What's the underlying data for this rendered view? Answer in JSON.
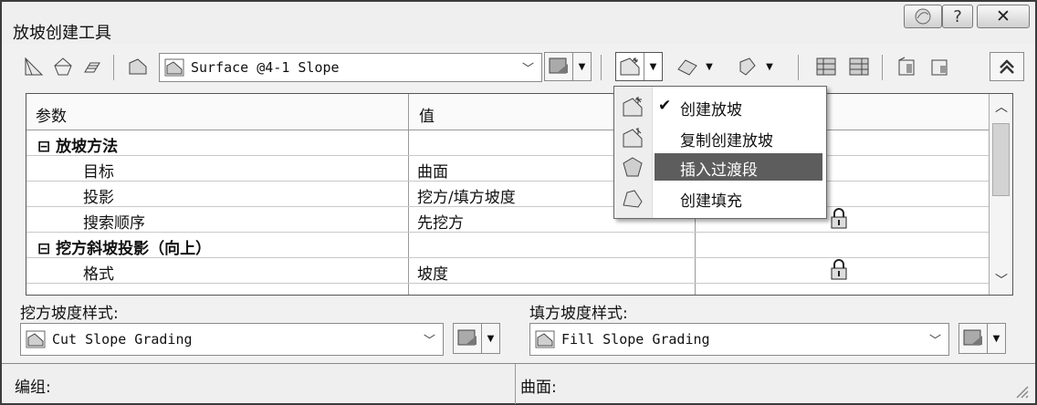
{
  "window": {
    "title": "放坡创建工具"
  },
  "toolbar": {
    "surface_combo_value": "Surface @4-1 Slope",
    "icons": [
      "grading-group-icon",
      "target-surface-icon",
      "layers-icon",
      "surface-icon",
      "style-split-icon",
      "create-grading-icon",
      "insert-transition-icon",
      "vertex-icon",
      "table-icon",
      "list-icon",
      "edit-icon",
      "copy-icon",
      "collapse-icon"
    ]
  },
  "grid": {
    "col_param": "参数",
    "col_value": "值",
    "rows": [
      {
        "type": "category",
        "param": "放坡方法",
        "value": ""
      },
      {
        "type": "item",
        "param": "目标",
        "value": "曲面"
      },
      {
        "type": "item",
        "param": "投影",
        "value": "挖方/填方坡度"
      },
      {
        "type": "item",
        "param": "搜索顺序",
        "value": "先挖方",
        "locked": true
      },
      {
        "type": "category",
        "param": "挖方斜坡投影（向上）",
        "value": ""
      },
      {
        "type": "item",
        "param": "格式",
        "value": "坡度",
        "locked": true
      }
    ]
  },
  "cut_slope": {
    "label": "挖方坡度样式:",
    "value": "Cut Slope Grading"
  },
  "fill_slope": {
    "label": "填方坡度样式:",
    "value": "Fill Slope Grading"
  },
  "status": {
    "group_label": "编组:",
    "surface_label": "曲面:"
  },
  "menu": {
    "items": [
      {
        "label": "创建放坡",
        "checked": "✔",
        "highlighted": false
      },
      {
        "label": "复制创建放坡",
        "checked": "",
        "highlighted": false
      },
      {
        "label": "插入过渡段",
        "checked": "",
        "highlighted": true
      },
      {
        "label": "创建填充",
        "checked": "",
        "highlighted": false
      }
    ]
  }
}
